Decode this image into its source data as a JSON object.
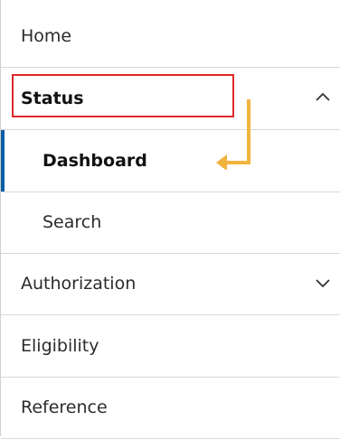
{
  "nav": {
    "items": [
      {
        "label": "Home"
      },
      {
        "label": "Status",
        "expanded": true
      },
      {
        "label": "Dashboard",
        "active": true
      },
      {
        "label": "Search"
      },
      {
        "label": "Authorization",
        "expanded": false
      },
      {
        "label": "Eligibility"
      },
      {
        "label": "Reference"
      }
    ]
  },
  "colors": {
    "active_indicator": "#0b5fa5",
    "highlight_box": "#e02828",
    "annotation_arrow": "#f2b33d"
  }
}
